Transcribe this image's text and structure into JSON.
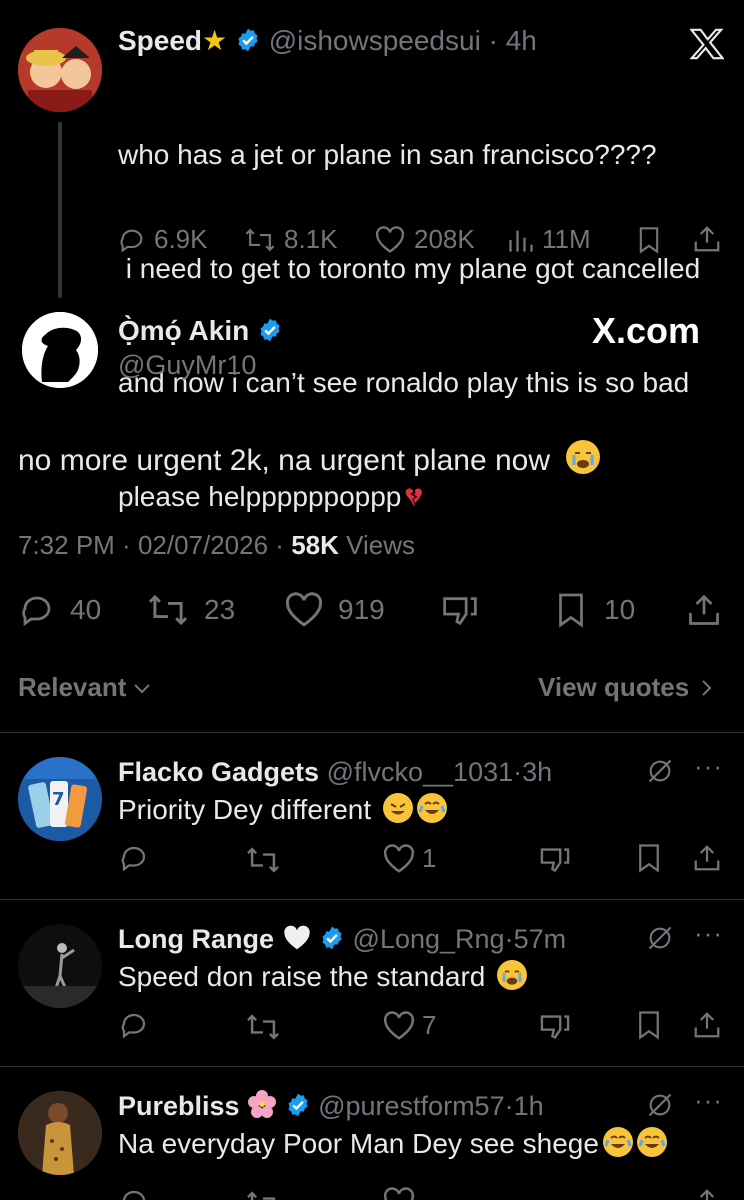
{
  "parent_tweet": {
    "name": "Speed",
    "handle": "@ishowspeedsui",
    "time": "4h",
    "text_lines": [
      "who has a jet or plane in san francisco????",
      " i need to get to toronto my plane got cancelled",
      "and now i can’t see ronaldo play this is so bad",
      "please helppppppoppp"
    ],
    "replies": "6.9K",
    "reposts": "8.1K",
    "likes": "208K",
    "views": "11M"
  },
  "main_tweet": {
    "name": "Ọ̀mọ́ Akin",
    "name_plain": "Ọmọ Akin",
    "handle": "@GuyMr10",
    "watermark": "X.com",
    "text": "no more urgent 2k, na urgent plane now",
    "time": "7:32 PM",
    "date": "02/07/2026",
    "views_count": "58K",
    "views_label": "Views",
    "replies": "40",
    "reposts": "23",
    "likes": "919",
    "bookmarks": "10"
  },
  "filter": {
    "sort_label": "Relevant",
    "quotes_label": "View quotes"
  },
  "replies": [
    {
      "name": "Flacko Gadgets",
      "handle": "@flvcko__1031",
      "time": "3h",
      "text": "Priority Dey different",
      "likes": "1",
      "verified": false
    },
    {
      "name": "Long Range",
      "handle": "@Long_Rng",
      "time": "57m",
      "text": "Speed don raise the standard",
      "likes": "7",
      "verified": true
    },
    {
      "name": "Purebliss",
      "handle": "@purestform57",
      "time": "1h",
      "text": "Na everyday Poor Man Dey see shege",
      "verified": true
    }
  ],
  "colors": {
    "background": "#000000",
    "text": "#e7e9ea",
    "muted": "#71767b",
    "verified": "#1d9bf0",
    "divider": "#2f3336"
  }
}
